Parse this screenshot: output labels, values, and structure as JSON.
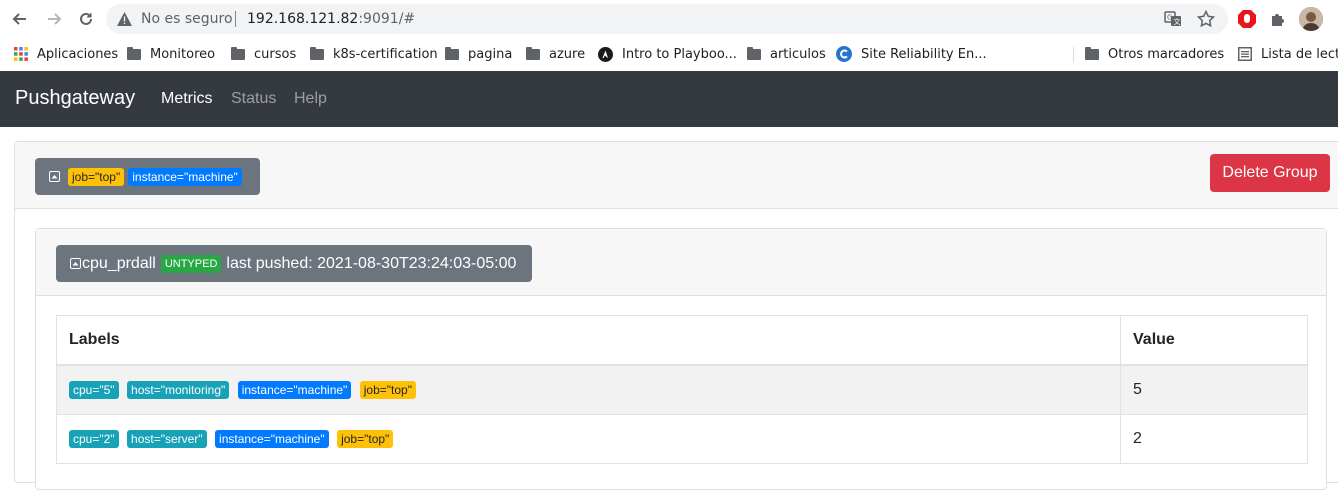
{
  "browser": {
    "security_text": "No es seguro",
    "url_host": "192.168.121.82",
    "url_rest": ":9091/#",
    "bookmarks": [
      {
        "label": "Aplicaciones",
        "icon": "apps-grid-icon"
      },
      {
        "label": "Monitoreo",
        "icon": "folder-icon"
      },
      {
        "label": "cursos",
        "icon": "folder-icon"
      },
      {
        "label": "k8s-certification",
        "icon": "folder-icon"
      },
      {
        "label": "pagina",
        "icon": "folder-icon"
      },
      {
        "label": "azure",
        "icon": "folder-icon"
      },
      {
        "label": "Intro to Playboo...",
        "icon": "ansible-icon"
      },
      {
        "label": "articulos",
        "icon": "folder-icon"
      },
      {
        "label": "Site Reliability En...",
        "icon": "coursera-icon"
      },
      {
        "label": "Otros marcadores",
        "icon": "folder-icon"
      },
      {
        "label": "Lista de lectu",
        "icon": "reading-list-icon"
      }
    ]
  },
  "navbar": {
    "brand": "Pushgateway",
    "links": [
      "Metrics",
      "Status",
      "Help"
    ],
    "active": "Metrics"
  },
  "group": {
    "labels": [
      "job=\"top\"",
      "instance=\"machine\""
    ],
    "delete_label": "Delete Group",
    "metric": {
      "name": "cpu_prdall",
      "type": "UNTYPED",
      "last_pushed": "last pushed: 2021-08-30T23:24:03-05:00",
      "table": {
        "headers": [
          "Labels",
          "Value"
        ],
        "rows": [
          {
            "labels": [
              "cpu=\"5\"",
              "host=\"monitoring\"",
              "instance=\"machine\"",
              "job=\"top\""
            ],
            "value": "5"
          },
          {
            "labels": [
              "cpu=\"2\"",
              "host=\"server\"",
              "instance=\"machine\"",
              "job=\"top\""
            ],
            "value": "2"
          }
        ]
      }
    }
  },
  "colors": {
    "navbar": "#343a40",
    "badge_job": "#ffc107",
    "badge_instance": "#007bff",
    "badge_other": "#17a2b8",
    "badge_type": "#28a745",
    "delete": "#dc3545"
  }
}
